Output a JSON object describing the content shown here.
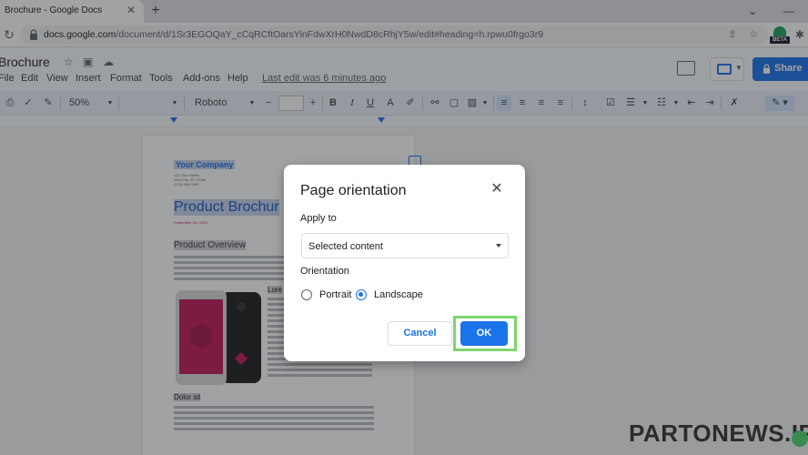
{
  "browser": {
    "tab_title": "Brochure - Google Docs",
    "tab_close": "✕",
    "new_tab": "+",
    "win_chevron": "⌄",
    "win_minimize": "—",
    "url_host": "docs.google.com",
    "url_path": "/document/d/1Sr3EGOQaY_cCqRCftOarsYinFdwXrH0NwdD8cRhjY5w/edit#heading=h.rpwu0frgo3r9",
    "beta_label": "BETA"
  },
  "docs": {
    "title": "Brochure",
    "menu": [
      "File",
      "Edit",
      "View",
      "Insert",
      "Format",
      "Tools",
      "Add-ons",
      "Help"
    ],
    "last_edit": "Last edit was 6 minutes ago",
    "share_label": "Share"
  },
  "toolbar": {
    "zoom": "50%",
    "font": "Roboto",
    "minus": "−",
    "plus": "+",
    "bold": "B",
    "italic": "I",
    "underline": "U",
    "text_color": "A"
  },
  "page": {
    "company": "Your Company",
    "address": [
      "123 Your Street",
      "Your City, ST 12345",
      "(123) 456-7890"
    ],
    "heading": "Product Brochur",
    "date": "September 04, 20XX",
    "overview": "Product Overview",
    "subheading": "Lore",
    "dolor": "Dolor sit"
  },
  "dialog": {
    "title": "Page orientation",
    "close": "✕",
    "apply_to_label": "Apply to",
    "apply_to_value": "Selected content",
    "orientation_label": "Orientation",
    "options": [
      {
        "label": "Portrait",
        "checked": false
      },
      {
        "label": "Landscape",
        "checked": true
      }
    ],
    "cancel_label": "Cancel",
    "ok_label": "OK"
  },
  "watermark": "PARTONEWS.IR",
  "colors": {
    "accent": "#1a73e8",
    "highlight": "#7ed56f",
    "share": "#1a73e8"
  }
}
